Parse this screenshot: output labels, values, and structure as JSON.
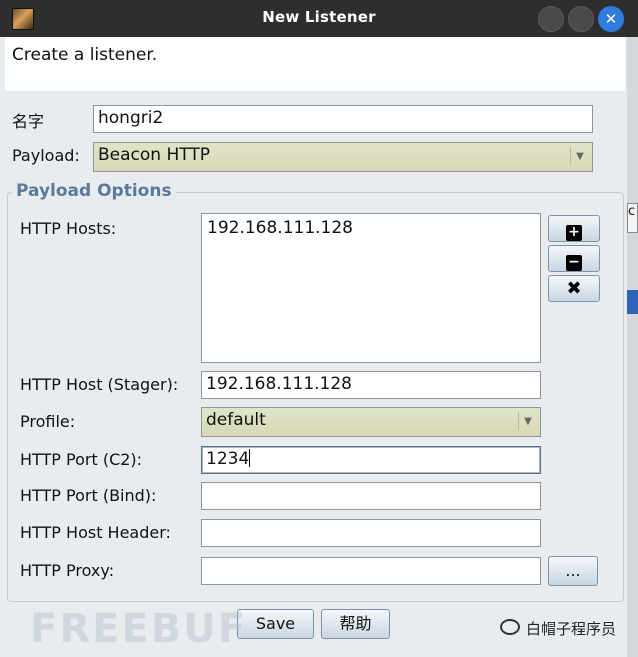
{
  "window": {
    "title": "New Listener"
  },
  "description": "Create a listener.",
  "name_field": {
    "label": "名字",
    "value": "hongri2"
  },
  "payload_field": {
    "label": "Payload:",
    "value": "Beacon HTTP"
  },
  "options": {
    "group_title": "Payload Options",
    "http_hosts": {
      "label": "HTTP Hosts:",
      "items": [
        "192.168.111.128"
      ]
    },
    "host_stager": {
      "label": "HTTP Host (Stager):",
      "value": "192.168.111.128"
    },
    "profile": {
      "label": "Profile:",
      "value": "default"
    },
    "port_c2": {
      "label": "HTTP Port (C2):",
      "value": "1234"
    },
    "port_bind": {
      "label": "HTTP Port (Bind):",
      "value": ""
    },
    "host_header": {
      "label": "HTTP Host Header:",
      "value": ""
    },
    "proxy": {
      "label": "HTTP Proxy:",
      "value": "",
      "browse_label": "..."
    }
  },
  "buttons": {
    "save": "Save",
    "help": "帮助"
  },
  "side_buttons": {
    "add": "+",
    "remove": "−",
    "clear": "✖"
  },
  "window_controls": {
    "close_glyph": "✕"
  },
  "background_fragment": "c",
  "watermark": {
    "brand": "FREEBUF",
    "account": "白帽子程序员"
  },
  "colors": {
    "titlebar": "#2e2e2e",
    "close_button": "#2f7bde",
    "group_title": "#5a7a9c",
    "combo_fill": "#d6d9b6"
  }
}
